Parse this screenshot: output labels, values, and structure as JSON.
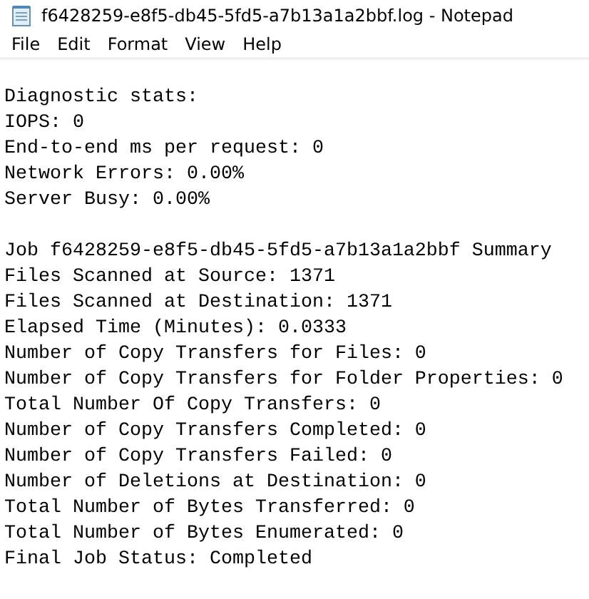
{
  "window": {
    "title": "f6428259-e8f5-db45-5fd5-a7b13a1a2bbf.log - Notepad"
  },
  "menu": [
    "File",
    "Edit",
    "Format",
    "View",
    "Help"
  ],
  "sections": [
    [
      "Diagnostic stats:",
      "IOPS: 0",
      "End-to-end ms per request: 0",
      "Network Errors: 0.00%",
      "Server Busy: 0.00%"
    ],
    [
      "Job f6428259-e8f5-db45-5fd5-a7b13a1a2bbf Summary",
      "Files Scanned at Source: 1371",
      "Files Scanned at Destination: 1371",
      "Elapsed Time (Minutes): 0.0333",
      "Number of Copy Transfers for Files: 0",
      "Number of Copy Transfers for Folder Properties: 0",
      "Total Number Of Copy Transfers: 0",
      "Number of Copy Transfers Completed: 0",
      "Number of Copy Transfers Failed: 0",
      "Number of Deletions at Destination: 0",
      "Total Number of Bytes Transferred: 0",
      "Total Number of Bytes Enumerated: 0",
      "Final Job Status: Completed"
    ]
  ]
}
